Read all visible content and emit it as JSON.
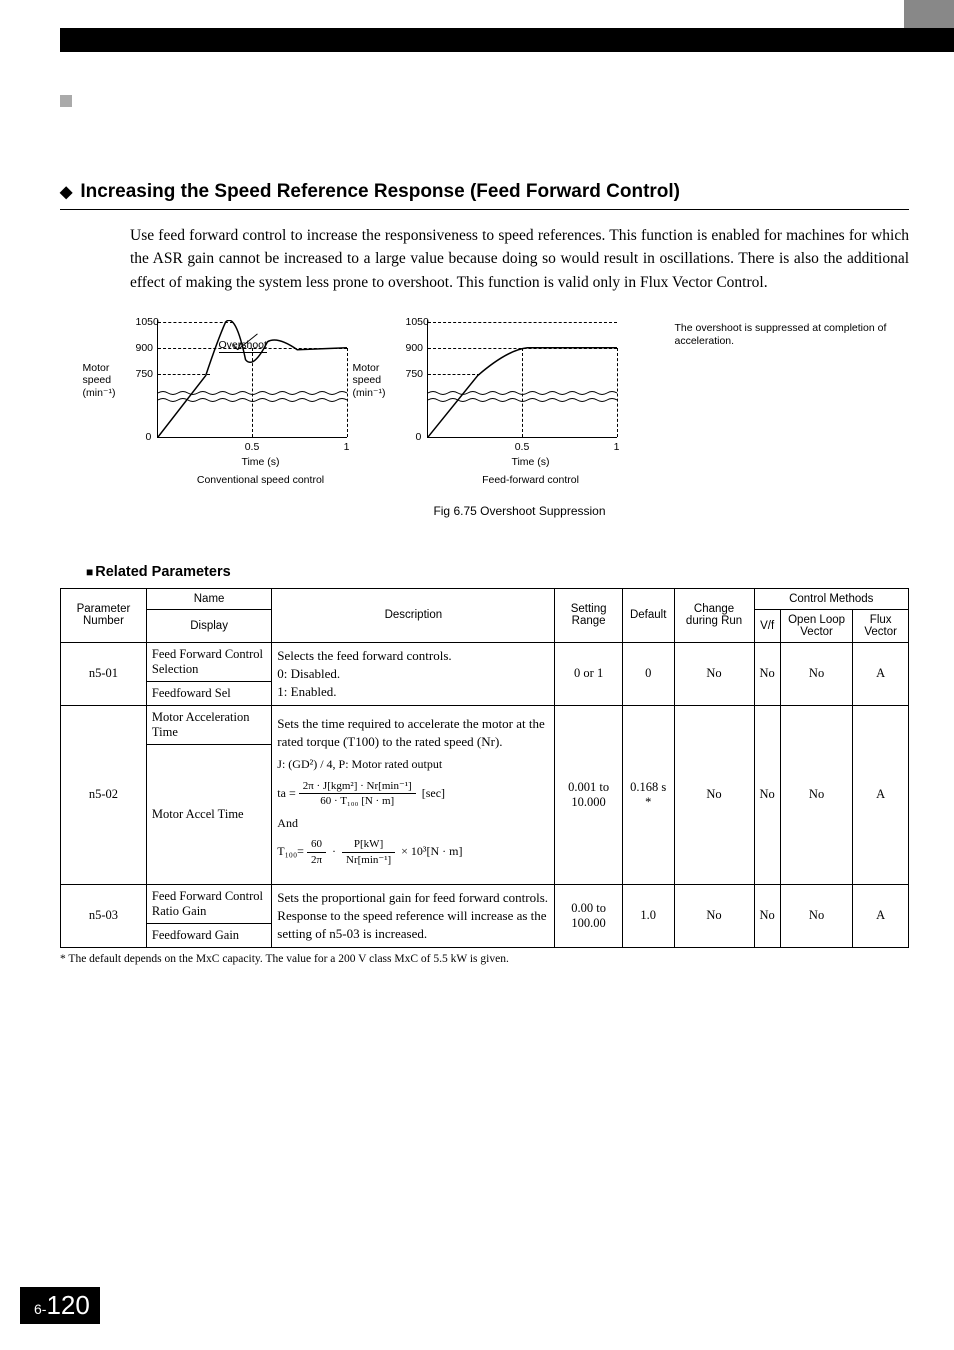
{
  "section": {
    "title": "Increasing the Speed Reference Response (Feed Forward Control)",
    "intro": "Use feed forward control to increase the responsiveness to speed references. This function is enabled for machines for which the ASR gain cannot be increased to a large value because doing so would result in oscillations. There is also the additional effect of making the system less prone to overshoot. This function is valid only in Flux Vector Control."
  },
  "chart_data": [
    {
      "type": "line",
      "title": "Conventional speed control",
      "ylabel_lines": [
        "Motor",
        "speed",
        "(min⁻¹)"
      ],
      "xlabel": "Time (s)",
      "y_ticks": [
        "0",
        "750",
        "900",
        "1050"
      ],
      "x_ticks": [
        "0",
        "0.5",
        "1"
      ],
      "annotation": "Overshoot",
      "ylim": [
        0,
        1100
      ],
      "xlim": [
        0,
        1
      ],
      "series": [
        {
          "name": "response",
          "x": [
            0,
            0.25,
            0.35,
            0.45,
            0.6,
            0.8,
            1.0
          ],
          "y": [
            0,
            750,
            1050,
            850,
            940,
            900,
            900
          ]
        }
      ]
    },
    {
      "type": "line",
      "title": "Feed-forward control",
      "ylabel_lines": [
        "Motor",
        "speed",
        "(min⁻¹)"
      ],
      "xlabel": "Time (s)",
      "y_ticks": [
        "0",
        "750",
        "900",
        "1050"
      ],
      "x_ticks": [
        "0",
        "0.5",
        "1"
      ],
      "ylim": [
        0,
        1100
      ],
      "xlim": [
        0,
        1
      ],
      "series": [
        {
          "name": "response",
          "x": [
            0,
            0.3,
            0.5,
            1.0
          ],
          "y": [
            0,
            850,
            900,
            900
          ]
        }
      ]
    }
  ],
  "side_note": "The overshoot is suppressed at completion of acceleration.",
  "figcaption": "Fig 6.75  Overshoot Suppression",
  "subhead": "Related Parameters",
  "table": {
    "headers": {
      "param": "Parameter Number",
      "name": "Name",
      "display": "Display",
      "description": "Description",
      "range": "Setting Range",
      "default": "Default",
      "change": "Change during Run",
      "methods": "Control Methods",
      "vf": "V/f",
      "olv": "Open Loop Vector",
      "flux": "Flux Vector"
    },
    "rows": [
      {
        "num": "n5-01",
        "name": "Feed Forward Control Selection",
        "display": "Feedfoward Sel",
        "desc_lines": [
          "Selects the feed forward controls.",
          "0:  Disabled.",
          "1:  Enabled."
        ],
        "range": "0 or 1",
        "default": "0",
        "change": "No",
        "vf": "No",
        "olv": "No",
        "flux": "A"
      },
      {
        "num": "n5-02",
        "name": "Motor Acceleration Time",
        "display": "Motor Accel Time",
        "desc_top": "Sets the time required to accelerate the motor at the rated torque (T100) to the rated speed (Nr).",
        "desc_j": "J: (GD²) / 4, P: Motor rated output",
        "ta_num": "2π · J[kgm²] · Nr[min⁻¹]",
        "ta_den": "60 · T₁₀₀ [N · m]",
        "ta_unit": "[sec]",
        "and": "And",
        "t100_a_num": "60",
        "t100_a_den": "2π",
        "t100_b_num": "P[kW]",
        "t100_b_den": "Nr[min⁻¹]",
        "t100_tail": "× 10³[N · m]",
        "range": "0.001 to 10.000",
        "default": "0.168 s *",
        "change": "No",
        "vf": "No",
        "olv": "No",
        "flux": "A"
      },
      {
        "num": "n5-03",
        "name": "Feed Forward Control Ratio Gain",
        "display": "Feedfoward Gain",
        "desc_lines": [
          "Sets the proportional gain for feed forward controls.",
          "Response to the speed reference will increase as the setting of n5-03 is increased."
        ],
        "range": "0.00 to 100.00",
        "default": "1.0",
        "change": "No",
        "vf": "No",
        "olv": "No",
        "flux": "A"
      }
    ]
  },
  "footnote": "*  The default depends on the MxC capacity. The value for a 200 V class MxC of 5.5 kW is given.",
  "page": {
    "prefix": "6-",
    "num": "120"
  }
}
